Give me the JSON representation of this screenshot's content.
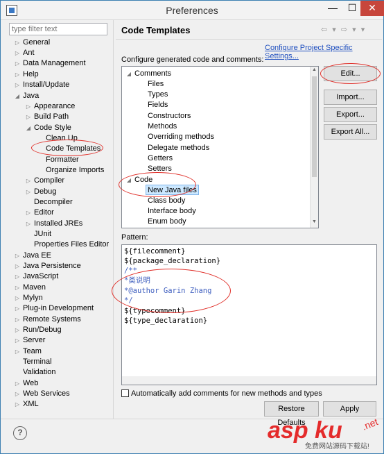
{
  "window": {
    "title": "Preferences",
    "min_glyph": "—",
    "max_glyph": "☐",
    "close_glyph": "✕"
  },
  "filter": {
    "placeholder": "type filter text"
  },
  "nav_tree": [
    {
      "label": "General",
      "expander": "▷"
    },
    {
      "label": "Ant",
      "expander": "▷"
    },
    {
      "label": "Data Management",
      "expander": "▷"
    },
    {
      "label": "Help",
      "expander": "▷"
    },
    {
      "label": "Install/Update",
      "expander": "▷"
    },
    {
      "label": "Java",
      "expander": "◢"
    },
    {
      "label": "Appearance",
      "expander": "▷"
    },
    {
      "label": "Build Path",
      "expander": "▷"
    },
    {
      "label": "Code Style",
      "expander": "◢"
    },
    {
      "label": "Clean Up",
      "expander": ""
    },
    {
      "label": "Code Templates",
      "expander": ""
    },
    {
      "label": "Formatter",
      "expander": ""
    },
    {
      "label": "Organize Imports",
      "expander": ""
    },
    {
      "label": "Compiler",
      "expander": "▷"
    },
    {
      "label": "Debug",
      "expander": "▷"
    },
    {
      "label": "Decompiler",
      "expander": ""
    },
    {
      "label": "Editor",
      "expander": "▷"
    },
    {
      "label": "Installed JREs",
      "expander": "▷"
    },
    {
      "label": "JUnit",
      "expander": ""
    },
    {
      "label": "Properties Files Editor",
      "expander": ""
    },
    {
      "label": "Java EE",
      "expander": "▷"
    },
    {
      "label": "Java Persistence",
      "expander": "▷"
    },
    {
      "label": "JavaScript",
      "expander": "▷"
    },
    {
      "label": "Maven",
      "expander": "▷"
    },
    {
      "label": "Mylyn",
      "expander": "▷"
    },
    {
      "label": "Plug-in Development",
      "expander": "▷"
    },
    {
      "label": "Remote Systems",
      "expander": "▷"
    },
    {
      "label": "Run/Debug",
      "expander": "▷"
    },
    {
      "label": "Server",
      "expander": "▷"
    },
    {
      "label": "Team",
      "expander": "▷"
    },
    {
      "label": "Terminal",
      "expander": ""
    },
    {
      "label": "Validation",
      "expander": ""
    },
    {
      "label": "Web",
      "expander": "▷"
    },
    {
      "label": "Web Services",
      "expander": "▷"
    },
    {
      "label": "XML",
      "expander": "▷"
    }
  ],
  "page": {
    "title": "Code Templates",
    "nav_glyphs": "⇦ ▾ ⇨ ▾ ▾",
    "link": "Configure Project Specific Settings...",
    "configure_label": "Configure generated code and comments:",
    "pattern_label": "Pattern:",
    "auto_comments_label": "Automatically add comments for new methods and types"
  },
  "templates_tree": [
    {
      "label": "Comments",
      "expander": "◢"
    },
    {
      "label": "Files",
      "expander": ""
    },
    {
      "label": "Types",
      "expander": ""
    },
    {
      "label": "Fields",
      "expander": ""
    },
    {
      "label": "Constructors",
      "expander": ""
    },
    {
      "label": "Methods",
      "expander": ""
    },
    {
      "label": "Overriding methods",
      "expander": ""
    },
    {
      "label": "Delegate methods",
      "expander": ""
    },
    {
      "label": "Getters",
      "expander": ""
    },
    {
      "label": "Setters",
      "expander": ""
    },
    {
      "label": "Code",
      "expander": "◢"
    },
    {
      "label": "New Java files",
      "expander": ""
    },
    {
      "label": "Class body",
      "expander": ""
    },
    {
      "label": "Interface body",
      "expander": ""
    },
    {
      "label": "Enum body",
      "expander": ""
    }
  ],
  "buttons": {
    "edit": "Edit...",
    "import": "Import...",
    "export": "Export...",
    "export_all": "Export All...",
    "restore_defaults": "Restore Defaults",
    "apply": "Apply"
  },
  "pattern_lines": [
    "${filecomment}",
    "${package_declaration}",
    "/**",
    "*类说明",
    "*@author Garin Zhang",
    "*/",
    "${typecomment}",
    "${type_declaration}"
  ],
  "help_glyph": "?",
  "watermark": {
    "main": "asp ku",
    "sub": "免费网站源码下载站!",
    "net": ".net"
  },
  "colors": {
    "link": "#1f4fbf",
    "comment": "#3f5fbf",
    "annotation_ring": "#e0302a",
    "selection": "#cce8ff",
    "close_button": "#c7463c"
  }
}
